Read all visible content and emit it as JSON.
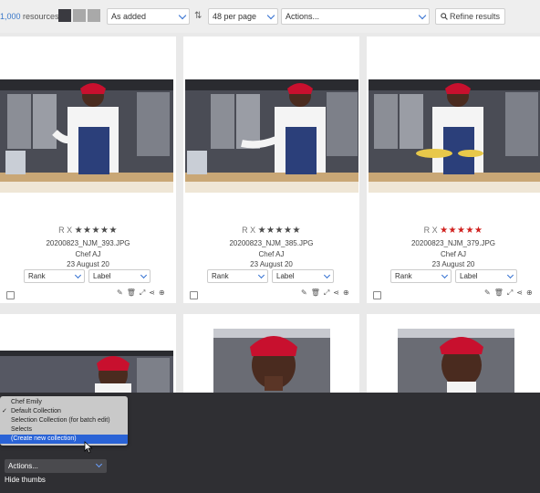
{
  "toolbar": {
    "count_number": "1,000",
    "count_suffix": " resources",
    "sort_value": "As added",
    "per_page_value": "48 per page",
    "actions_value": "Actions...",
    "refine_label": "Refine results"
  },
  "cards": [
    {
      "rating_prefix": "R X",
      "stars": "★★★★★",
      "star_color": "#4a4a4a",
      "filename": "20200823_NJM_393.JPG",
      "author": "Chef AJ",
      "date": "23 August 20",
      "rank_label": "Rank",
      "label_label": "Label"
    },
    {
      "rating_prefix": "R X",
      "stars": "★★★★★",
      "star_color": "#4a4a4a",
      "filename": "20200823_NJM_385.JPG",
      "author": "Chef AJ",
      "date": "23 August 20",
      "rank_label": "Rank",
      "label_label": "Label"
    },
    {
      "rating_prefix": "R X",
      "stars": "★★★★★",
      "star_color": "#d0201d",
      "filename": "20200823_NJM_379.JPG",
      "author": "Chef AJ",
      "date": "23 August 20",
      "rank_label": "Rank",
      "label_label": "Label"
    }
  ],
  "collection_menu": {
    "items": [
      {
        "label": "Chef Emily",
        "checked": false,
        "highlighted": false
      },
      {
        "label": "Default Collection",
        "checked": true,
        "highlighted": false
      },
      {
        "label": "Selection Collection (for batch edit)",
        "checked": false,
        "highlighted": false
      },
      {
        "label": "Selects",
        "checked": false,
        "highlighted": false
      },
      {
        "label": "(Create new collection)",
        "checked": false,
        "highlighted": true
      }
    ]
  },
  "bottom": {
    "actions_value": "Actions...",
    "hide_thumbs_label": "Hide thumbs"
  },
  "colors": {
    "accent": "#2f6dd0",
    "bandana": "#c8102e",
    "apron": "#2b3f7a",
    "menu_highlight": "#2a63d6"
  },
  "icons": [
    "grid-view-icon",
    "sort-icon",
    "search-icon",
    "edit-icon",
    "trash-icon",
    "expand-icon",
    "share-icon",
    "add-icon",
    "cursor-icon"
  ]
}
